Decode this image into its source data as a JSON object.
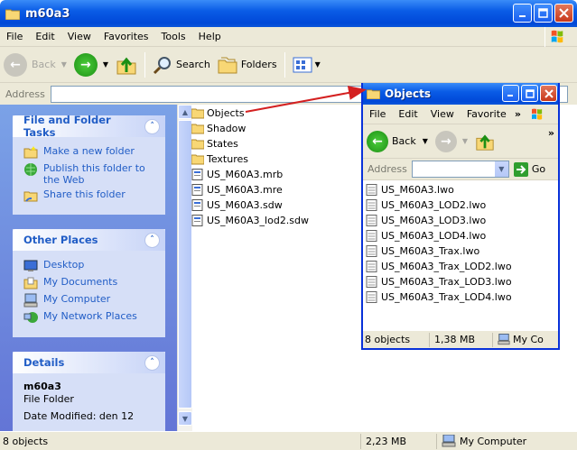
{
  "main": {
    "title": "m60a3",
    "menu": [
      "File",
      "Edit",
      "View",
      "Favorites",
      "Tools",
      "Help"
    ],
    "toolbar": {
      "back": "Back",
      "search": "Search",
      "folders": "Folders"
    },
    "address_label": "Address",
    "tasks": {
      "file_tasks": {
        "title": "File and Folder Tasks",
        "items": [
          "Make a new folder",
          "Publish this folder to the Web",
          "Share this folder"
        ]
      },
      "other_places": {
        "title": "Other Places",
        "items": [
          "Desktop",
          "My Documents",
          "My Computer",
          "My Network Places"
        ]
      },
      "details": {
        "title": "Details",
        "name": "m60a3",
        "type": "File Folder",
        "modified": "Date Modified: den 12"
      }
    },
    "files": [
      {
        "name": "Objects",
        "kind": "folder"
      },
      {
        "name": "Shadow",
        "kind": "folder"
      },
      {
        "name": "States",
        "kind": "folder"
      },
      {
        "name": "Textures",
        "kind": "folder"
      },
      {
        "name": "US_M60A3.mrb",
        "kind": "file"
      },
      {
        "name": "US_M60A3.mre",
        "kind": "file"
      },
      {
        "name": "US_M60A3.sdw",
        "kind": "file"
      },
      {
        "name": "US_M60A3_lod2.sdw",
        "kind": "file"
      }
    ],
    "status": {
      "count": "8 objects",
      "size": "2,23 MB",
      "location": "My Computer"
    }
  },
  "overlay": {
    "title": "Objects",
    "menu": [
      "File",
      "Edit",
      "View",
      "Favorite",
      "»"
    ],
    "toolbar": {
      "back": "Back",
      "more": "»"
    },
    "address_label": "Address",
    "go": "Go",
    "files": [
      "US_M60A3.lwo",
      "US_M60A3_LOD2.lwo",
      "US_M60A3_LOD3.lwo",
      "US_M60A3_LOD4.lwo",
      "US_M60A3_Trax.lwo",
      "US_M60A3_Trax_LOD2.lwo",
      "US_M60A3_Trax_LOD3.lwo",
      "US_M60A3_Trax_LOD4.lwo"
    ],
    "status": {
      "count": "8 objects",
      "size": "1,38 MB",
      "location": "My Co"
    }
  },
  "colors": {
    "xp_blue": "#0a5ce6",
    "task_link": "#215dc6",
    "arrow": "#d42020"
  }
}
